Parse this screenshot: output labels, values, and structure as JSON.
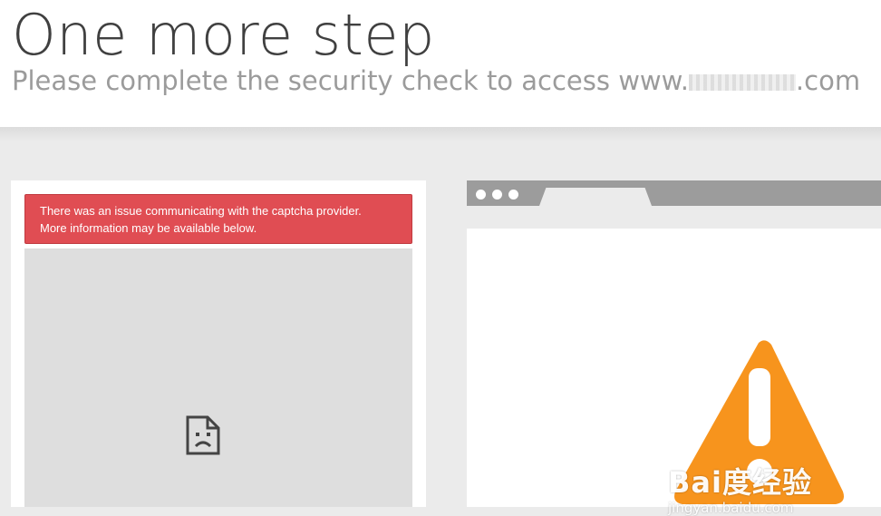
{
  "header": {
    "title": "One more step",
    "subtitle_prefix": "Please complete the security check to access www.",
    "subtitle_suffix": ".com"
  },
  "captcha": {
    "error_line1": "There was an issue communicating with the captcha provider.",
    "error_line2": "More information may be available below.",
    "broken_icon": "sad-document-icon"
  },
  "illustration": {
    "warning_icon": "warning-triangle-icon",
    "warning_color": "#f7941d",
    "bar_color": "#9c9c9c"
  },
  "watermark": {
    "brand": "Bai度经验",
    "url": "jingyan.baidu.com"
  },
  "colors": {
    "error_bg": "#e04d53",
    "panel_bg": "#ebebeb"
  }
}
